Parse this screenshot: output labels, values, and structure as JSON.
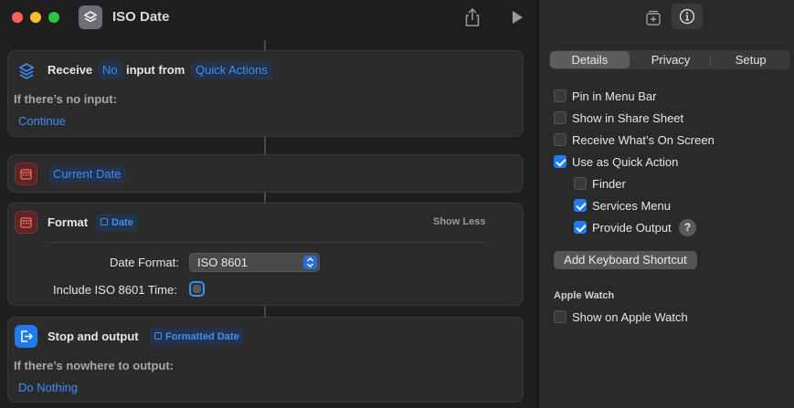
{
  "window": {
    "title": "ISO Date"
  },
  "actions": {
    "receive": {
      "label": "Receive",
      "input_token": "No",
      "input_from_label": "input from",
      "source_token": "Quick Actions",
      "no_input_label": "If there’s no input:",
      "no_input_value": "Continue"
    },
    "current_date": {
      "token": "Current Date"
    },
    "format": {
      "label": "Format",
      "token": "Date",
      "show_less": "Show Less",
      "date_format_label": "Date Format:",
      "date_format_value": "ISO 8601",
      "include_time_label": "Include ISO 8601 Time:"
    },
    "stop_output": {
      "label": "Stop and output",
      "token": "Formatted Date",
      "nowhere_label": "If there’s nowhere to output:",
      "nowhere_value": "Do Nothing"
    }
  },
  "inspector": {
    "tabs": [
      "Details",
      "Privacy",
      "Setup"
    ],
    "active_tab": "Details",
    "options": {
      "pin_menu_bar": {
        "label": "Pin in Menu Bar",
        "checked": false
      },
      "share_sheet": {
        "label": "Show in Share Sheet",
        "checked": false
      },
      "receive_screen": {
        "label": "Receive What’s On Screen",
        "checked": false
      },
      "quick_action": {
        "label": "Use as Quick Action",
        "checked": true
      },
      "finder": {
        "label": "Finder",
        "checked": false
      },
      "services_menu": {
        "label": "Services Menu",
        "checked": true
      },
      "provide_output": {
        "label": "Provide Output",
        "checked": true
      }
    },
    "help_label": "?",
    "keyboard_shortcut_button": "Add Keyboard Shortcut",
    "apple_watch_heading": "Apple Watch",
    "show_on_watch": {
      "label": "Show on Apple Watch",
      "checked": false
    }
  },
  "colors": {
    "accent": "#1e7bf0",
    "token_text": "#3d8ff5",
    "calendar_icon": "#5a2626",
    "close": "#ff5f57",
    "minimize": "#febc2e",
    "maximize": "#28c840"
  },
  "icons": [
    "shortcuts-app-icon",
    "share-icon",
    "play-icon",
    "receive-icon",
    "calendar-icon",
    "output-icon",
    "add-library-icon",
    "info-icon",
    "select-arrows-icon"
  ]
}
